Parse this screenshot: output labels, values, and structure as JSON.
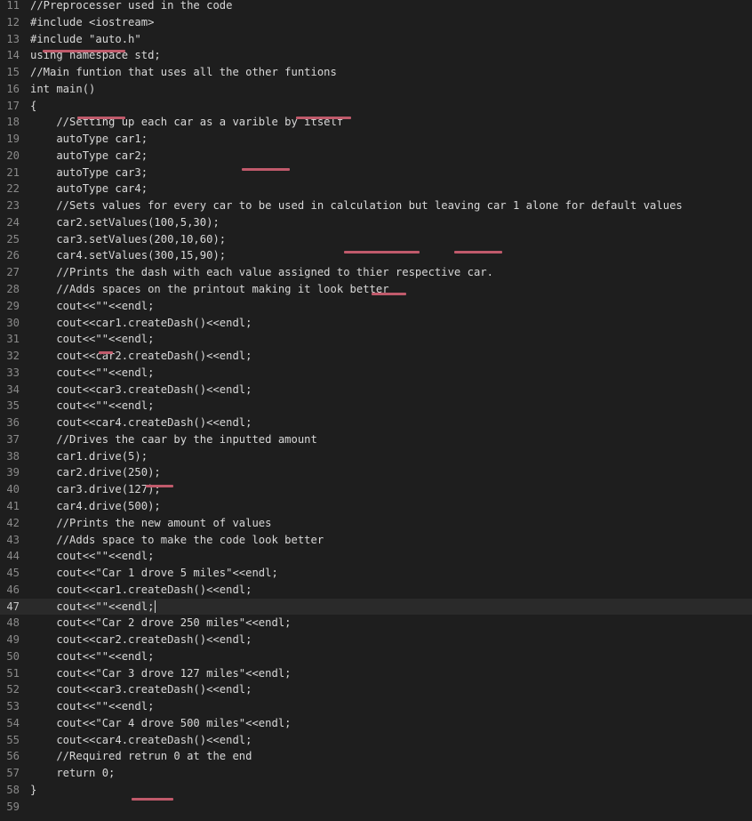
{
  "editor": {
    "current_line": "47",
    "lines": [
      {
        "n": "11",
        "text": "//Preprocesser used in the code"
      },
      {
        "n": "12",
        "text": "#include <iostream>"
      },
      {
        "n": "13",
        "text": "#include \"auto.h\""
      },
      {
        "n": "14",
        "text": "using namespace std;"
      },
      {
        "n": "15",
        "text": "//Main funtion that uses all the other funtions"
      },
      {
        "n": "16",
        "text": "int main()"
      },
      {
        "n": "17",
        "text": "{"
      },
      {
        "n": "18",
        "text": "    //Setting up each car as a varible by itself"
      },
      {
        "n": "19",
        "text": "    autoType car1;"
      },
      {
        "n": "20",
        "text": "    autoType car2;"
      },
      {
        "n": "21",
        "text": "    autoType car3;"
      },
      {
        "n": "22",
        "text": "    autoType car4;"
      },
      {
        "n": "23",
        "text": "    //Sets values for every car to be used in calculation but leaving car 1 alone for default values"
      },
      {
        "n": "24",
        "text": "    car2.setValues(100,5,30);"
      },
      {
        "n": "25",
        "text": "    car3.setValues(200,10,60);"
      },
      {
        "n": "26",
        "text": "    car4.setValues(300,15,90);"
      },
      {
        "n": "27",
        "text": "    //Prints the dash with each value assigned to thier respective car."
      },
      {
        "n": "28",
        "text": "    //Adds spaces on the printout making it look better"
      },
      {
        "n": "29",
        "text": "    cout<<\"\"<<endl;"
      },
      {
        "n": "30",
        "text": "    cout<<car1.createDash()<<endl;"
      },
      {
        "n": "31",
        "text": "    cout<<\"\"<<endl;"
      },
      {
        "n": "32",
        "text": "    cout<<car2.createDash()<<endl;"
      },
      {
        "n": "33",
        "text": "    cout<<\"\"<<endl;"
      },
      {
        "n": "34",
        "text": "    cout<<car3.createDash()<<endl;"
      },
      {
        "n": "35",
        "text": "    cout<<\"\"<<endl;"
      },
      {
        "n": "36",
        "text": "    cout<<car4.createDash()<<endl;"
      },
      {
        "n": "37",
        "text": "    //Drives the caar by the inputted amount"
      },
      {
        "n": "38",
        "text": "    car1.drive(5);"
      },
      {
        "n": "39",
        "text": "    car2.drive(250);"
      },
      {
        "n": "40",
        "text": "    car3.drive(127);"
      },
      {
        "n": "41",
        "text": "    car4.drive(500);"
      },
      {
        "n": "42",
        "text": "    //Prints the new amount of values"
      },
      {
        "n": "43",
        "text": "    //Adds space to make the code look better"
      },
      {
        "n": "44",
        "text": "    cout<<\"\"<<endl;"
      },
      {
        "n": "45",
        "text": "    cout<<\"Car 1 drove 5 miles\"<<endl;"
      },
      {
        "n": "46",
        "text": "    cout<<car1.createDash()<<endl;"
      },
      {
        "n": "47",
        "text": "    cout<<\"\"<<endl;"
      },
      {
        "n": "48",
        "text": "    cout<<\"Car 2 drove 250 miles\"<<endl;"
      },
      {
        "n": "49",
        "text": "    cout<<car2.createDash()<<endl;"
      },
      {
        "n": "50",
        "text": "    cout<<\"\"<<endl;"
      },
      {
        "n": "51",
        "text": "    cout<<\"Car 3 drove 127 miles\"<<endl;"
      },
      {
        "n": "52",
        "text": "    cout<<car3.createDash()<<endl;"
      },
      {
        "n": "53",
        "text": "    cout<<\"\"<<endl;"
      },
      {
        "n": "54",
        "text": "    cout<<\"Car 4 drove 500 miles\"<<endl;"
      },
      {
        "n": "55",
        "text": "    cout<<car4.createDash()<<endl;"
      },
      {
        "n": "56",
        "text": "    //Required retrun 0 at the end"
      },
      {
        "n": "57",
        "text": "    return 0;"
      },
      {
        "n": "58",
        "text": "}"
      },
      {
        "n": "59",
        "text": ""
      }
    ]
  },
  "colors": {
    "background": "#1e1e1e",
    "current_line_highlight": "#2a2a2a",
    "line_number": "#8a8a8a",
    "code_text": "#d8d8d8",
    "error_squiggle": "#c05a6b"
  }
}
